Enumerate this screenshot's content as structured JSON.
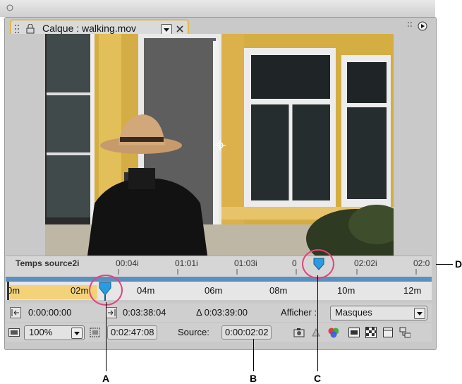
{
  "window": {
    "tab_label": "Calque : walking.mov"
  },
  "ruler": {
    "title": "Temps source2i",
    "labels": [
      "00:04i",
      "01:01i",
      "01:03i",
      "0",
      "02:02i",
      "02:0"
    ]
  },
  "timeline": {
    "labels": [
      "0m",
      "02m",
      "04m",
      "06m",
      "08m",
      "10m",
      "12m"
    ]
  },
  "row1": {
    "in_point": "0:00:00:00",
    "out_point": "0:03:38:04",
    "duration": "Δ 0:03:39:00",
    "show_label": "Afficher :",
    "show_value": "Masques"
  },
  "row2": {
    "zoom": "100%",
    "current_time": "0:02:47:08",
    "source_label": "Source:",
    "source_time": "0:00:02:02"
  },
  "callouts": {
    "a": "A",
    "b": "B",
    "c": "C",
    "d": "D"
  },
  "colors": {
    "accent": "#e2b84a",
    "highlight_circle": "#e0457f",
    "marker": "#2a9be0",
    "workarea": "#f3d27a"
  }
}
